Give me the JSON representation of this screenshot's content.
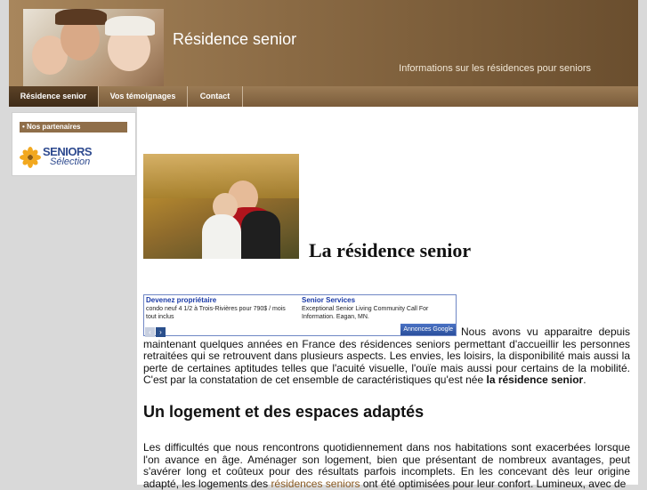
{
  "header": {
    "site_title": "Résidence senior",
    "tagline": "Informations sur les résidences pour seniors"
  },
  "nav": {
    "items": [
      {
        "label": "Résidence senior",
        "active": true
      },
      {
        "label": "Vos témoignages",
        "active": false
      },
      {
        "label": "Contact",
        "active": false
      }
    ]
  },
  "sidebar": {
    "heading": "• Nos partenaires",
    "partner": {
      "line1": "SENIORS",
      "line2": "Sélection"
    }
  },
  "main": {
    "title": "La résidence senior",
    "ad": {
      "items": [
        {
          "title": "Devenez propriétaire",
          "text": "condo neuf 4 1/2 à Trois-Rivières pour 790$ / mois tout inclus"
        },
        {
          "title": "Senior Services",
          "text": "Exceptional Senior Living Community Call For Information. Eagan, MN."
        }
      ],
      "prev": "‹",
      "next": "›",
      "google_label": "Annonces Google"
    },
    "intro_before": "Nous avons vu apparaitre depuis maintenant quelques années en France des résidences seniors permettant d'accueillir les personnes retraitées qui se retrouvent dans plusieurs aspects. Les envies, les loisirs, la disponibilité mais aussi la perte de certaines aptitudes telles que l'acuité visuelle, l'ouïe mais aussi pour certains de la mobilité. C'est par la constatation de cet ensemble de caractéristiques qu'est née ",
    "intro_bold": "la résidence senior",
    "intro_after": ".",
    "section_heading": "Un logement et des espaces adaptés",
    "para2_before": "Les difficultés que nous rencontrons quotidiennement dans nos habitations sont exacerbées lorsque l'on avance en âge. Aménager son logement, bien que présentant de nombreux avantages, peut s'avérer long et coûteux pour des résultats parfois incomplets. En les concevant dès leur origine adapté, les logements des ",
    "para2_link": "résidences seniors",
    "para2_after": " ont été optimisées pour leur confort. Lumineux, avec de"
  },
  "colors": {
    "header_brown": "#8a6a44",
    "nav_active": "#4a3420",
    "sidebar_head": "#8f6e49",
    "link": "#8a5a22",
    "ad_border": "#6f87c5"
  }
}
